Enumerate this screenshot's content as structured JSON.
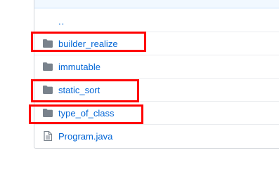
{
  "file_list": {
    "parent_link": "..",
    "items": [
      {
        "name": "builder_realize",
        "type": "folder",
        "icon": "folder-icon",
        "highlighted": true
      },
      {
        "name": "immutable",
        "type": "folder",
        "icon": "folder-icon",
        "highlighted": false
      },
      {
        "name": "static_sort",
        "type": "folder",
        "icon": "folder-icon",
        "highlighted": true
      },
      {
        "name": "type_of_class",
        "type": "folder",
        "icon": "folder-icon",
        "highlighted": true
      },
      {
        "name": "Program.java",
        "type": "file",
        "icon": "file-icon",
        "highlighted": false
      }
    ]
  },
  "colors": {
    "link": "#0366d6",
    "folder_icon": "#79828c",
    "highlight_border": "#ff0000",
    "row_divider": "#eaecef",
    "header_strip": "#f1f8ff"
  }
}
